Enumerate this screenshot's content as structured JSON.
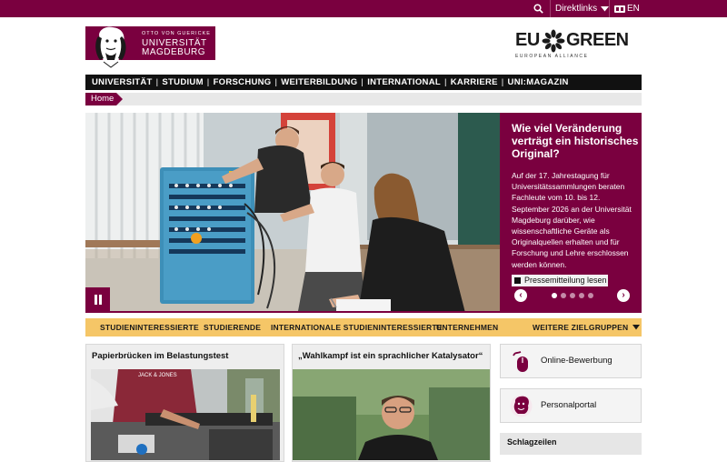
{
  "topbar": {
    "direktlinks_label": "Direktlinks",
    "lang_label": "EN"
  },
  "logo": {
    "line1": "OTTO VON GUERICKE",
    "line2": "UNIVERSITÄT",
    "line3": "MAGDEBURG"
  },
  "eu_logo": {
    "word1": "EU",
    "word2": "GREEN",
    "tagline": "EUROPEAN ALLIANCE"
  },
  "main_nav": [
    "UNIVERSITÄT",
    "STUDIUM",
    "FORSCHUNG",
    "WEITERBILDUNG",
    "INTERNATIONAL",
    "KARRIERE",
    "UNI:MAGAZIN"
  ],
  "breadcrumb": {
    "home": "Home"
  },
  "hero": {
    "headline": "Wie viel Veränderung verträgt ein historisches Original?",
    "body": "Auf der 17. Jahrestagung für Universitätssammlungen beraten Fachleute vom 10. bis 12. September 2026 an der Universität Magdeburg darüber, wie wissenschaftliche Geräte als Originalquellen erhalten und für Forschung und Lehre erschlossen werden können.",
    "button_label": "Pressemitteilung lesen",
    "slide_count": 5,
    "active_slide": 1
  },
  "target_groups": {
    "items": [
      "STUDIENINTERESSIERTE",
      "STUDIERENDE",
      "INTERNATIONALE STUDIENINTERESSIERTE",
      "UNTERNEHMEN"
    ],
    "more": "WEITERE ZIELGRUPPEN"
  },
  "cards": [
    {
      "title": "Papierbrücken im Belastungstest"
    },
    {
      "title": "„Wahlkampf ist ein sprachlicher Katalysator“"
    }
  ],
  "side_links": [
    {
      "label": "Online-Bewerbung",
      "icon": "mouse-icon"
    },
    {
      "label": "Personalportal",
      "icon": "guericke-portrait-icon"
    }
  ],
  "schlagzeilen": {
    "label": "Schlagzeilen"
  },
  "colors": {
    "brand": "#7a003f",
    "accent": "#f5c667",
    "nav": "#111111"
  }
}
